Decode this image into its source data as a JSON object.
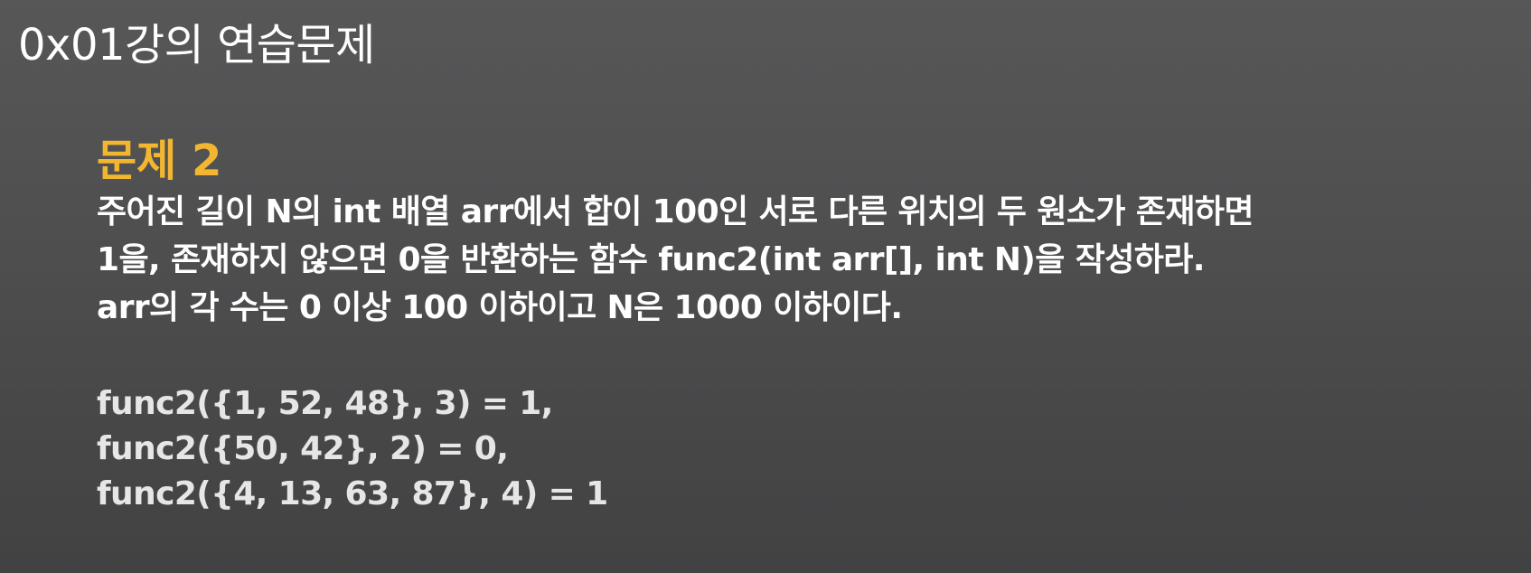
{
  "slide": {
    "title": "0x01강의 연습문제",
    "problem_heading": "문제 2",
    "description_lines": [
      "주어진 길이 N의 int 배열 arr에서 합이 100인 서로 다른 위치의 두 원소가 존재하면",
      "1을, 존재하지 않으면 0을 반환하는 함수 func2(int arr[], int N)을 작성하라.",
      "arr의 각 수는 0 이상 100 이하이고 N은 1000 이하이다."
    ],
    "examples": [
      "func2({1, 52, 48}, 3) = 1,",
      "func2({50, 42}, 2) = 0,",
      "func2({4, 13, 63, 87}, 4) = 1"
    ]
  },
  "colors": {
    "background": "#4f4f50",
    "heading_accent": "#f2b630",
    "text": "#ffffff",
    "example_text": "#e6e6e6"
  }
}
